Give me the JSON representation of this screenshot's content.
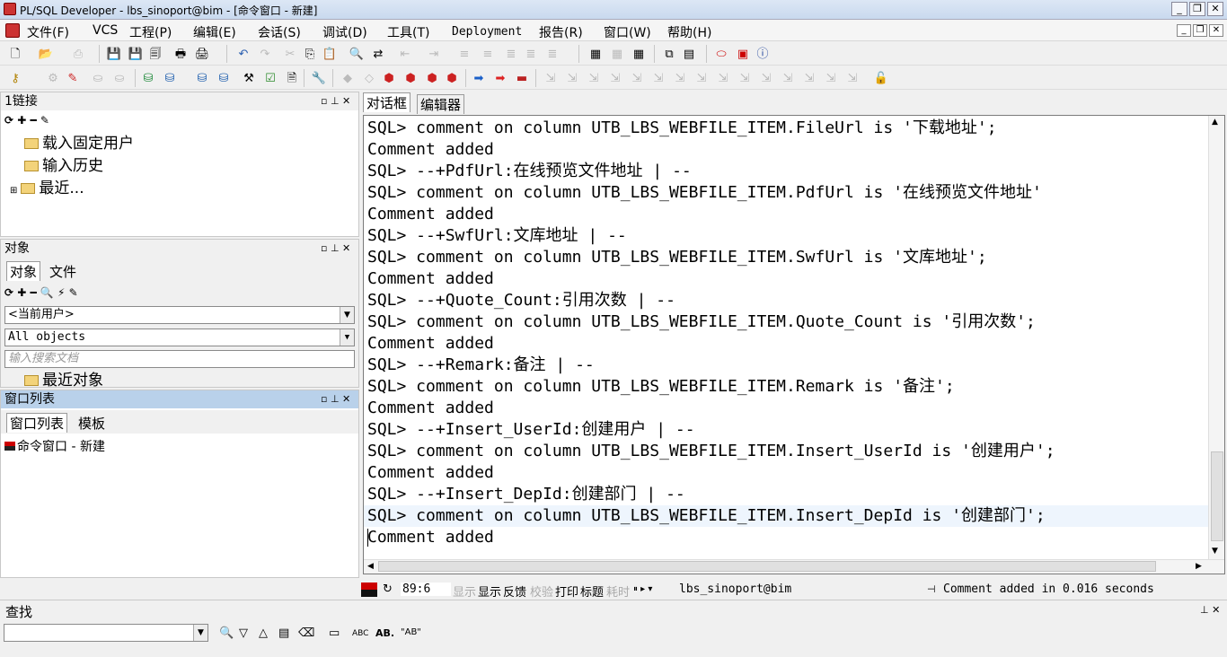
{
  "window": {
    "title": "PL/SQL Developer - lbs_sinoport@bim - [命令窗口 - 新建]"
  },
  "menu": [
    "文件(F)",
    "VCS",
    "工程(P)",
    "编辑(E)",
    "会话(S)",
    "调试(D)",
    "工具(T)",
    "Deployment",
    "报告(R)",
    "窗口(W)",
    "帮助(H)"
  ],
  "connections": {
    "title": "1链接",
    "items": [
      "载入固定用户",
      "输入历史",
      "最近..."
    ]
  },
  "objects": {
    "title": "对象",
    "tabs": [
      "对象",
      "文件"
    ],
    "user_combo": "<当前用户>",
    "filter_combo": "All objects",
    "search_placeholder": "输入搜索文档",
    "recent": "最近对象"
  },
  "windowlist": {
    "title": "窗口列表",
    "tabs": [
      "窗口列表",
      "模板"
    ],
    "item": "命令窗口 - 新建"
  },
  "editor_tabs": [
    "对话框",
    "编辑器"
  ],
  "editor_lines": [
    "SQL> comment on column UTB_LBS_WEBFILE_ITEM.FileUrl is '下载地址';",
    "Comment added",
    "SQL> --+PdfUrl:在线预览文件地址 | --",
    "SQL> comment on column UTB_LBS_WEBFILE_ITEM.PdfUrl is '在线预览文件地址'",
    "Comment added",
    "SQL> --+SwfUrl:文库地址 | --",
    "SQL> comment on column UTB_LBS_WEBFILE_ITEM.SwfUrl is '文库地址';",
    "Comment added",
    "SQL> --+Quote_Count:引用次数 | --",
    "SQL> comment on column UTB_LBS_WEBFILE_ITEM.Quote_Count is '引用次数';",
    "Comment added",
    "SQL> --+Remark:备注 | --",
    "SQL> comment on column UTB_LBS_WEBFILE_ITEM.Remark is '备注';",
    "Comment added",
    "SQL> --+Insert_UserId:创建用户 | --",
    "SQL> comment on column UTB_LBS_WEBFILE_ITEM.Insert_UserId is '创建用户';",
    "Comment added",
    "SQL> --+Insert_DepId:创建部门 | --",
    "SQL> comment on column UTB_LBS_WEBFILE_ITEM.Insert_DepId is '创建部门';",
    "Comment added"
  ],
  "status": {
    "position": "89:6",
    "display_dim": "显示",
    "display": "显示",
    "feedback": "反馈",
    "check": "校验",
    "print": "打印",
    "header": "标题",
    "timing": "耗时",
    "connection": "lbs_sinoport@bim",
    "message": "Comment added in 0.016 seconds"
  },
  "find": {
    "title": "查找",
    "abc": "ABC",
    "quoted": "\"AB\""
  },
  "colors": {
    "selection": "#eef5fd",
    "panel_title_active": "#b9d1ea"
  }
}
